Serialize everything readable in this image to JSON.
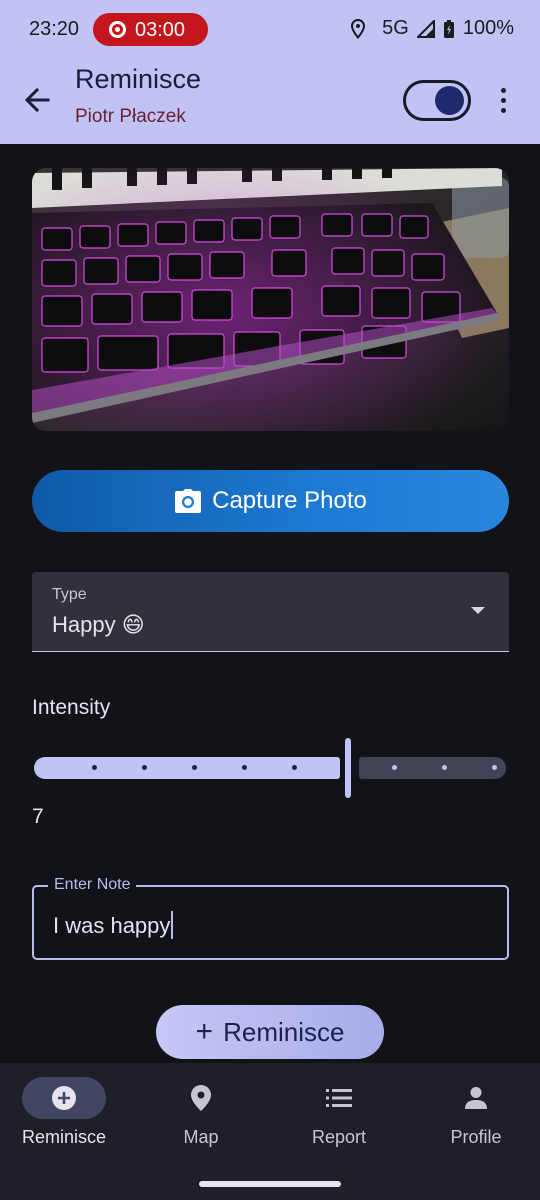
{
  "status_bar": {
    "time": "23:20",
    "recording_timer": "03:00",
    "network": "5G",
    "battery": "100%"
  },
  "app_bar": {
    "title": "Reminisce",
    "subtitle": "Piotr Płaczek",
    "toggle_on": true
  },
  "capture_button": {
    "label": "Capture Photo"
  },
  "type_field": {
    "label": "Type",
    "value": "Happy 😄"
  },
  "intensity": {
    "label": "Intensity",
    "value": "7",
    "min": 1,
    "max": 10
  },
  "note_field": {
    "label": "Enter Note",
    "value": "I was happy"
  },
  "submit_button": {
    "label": "Reminisce",
    "icon": "plus-icon"
  },
  "bottom_nav": {
    "items": [
      {
        "label": "Reminisce",
        "icon": "add-circle-icon",
        "active": true
      },
      {
        "label": "Map",
        "icon": "location-pin-icon",
        "active": false
      },
      {
        "label": "Report",
        "icon": "list-icon",
        "active": false
      },
      {
        "label": "Profile",
        "icon": "person-icon",
        "active": false
      }
    ]
  },
  "colors": {
    "app_bar_bg": "#c0c3f4",
    "background": "#111318",
    "accent": "#c0c3f4",
    "capture_button": "#1d7ad2",
    "recording_pill": "#c4161c"
  }
}
